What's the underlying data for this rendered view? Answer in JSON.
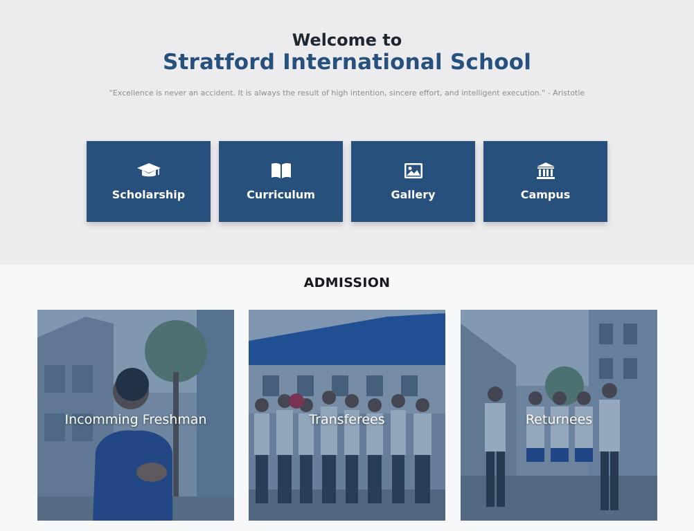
{
  "hero": {
    "welcome": "Welcome to",
    "school_name": "Stratford International School",
    "quote": "\"Excellence is never an accident. It is always the result of high intention, sincere effort, and intelligent execution.\" - Aristotle"
  },
  "quick_links": [
    {
      "label": "Scholarship",
      "icon": "graduation-cap-icon"
    },
    {
      "label": "Curriculum",
      "icon": "book-icon"
    },
    {
      "label": "Gallery",
      "icon": "image-icon"
    },
    {
      "label": "Campus",
      "icon": "institution-icon"
    }
  ],
  "admission": {
    "title": "ADMISSION",
    "cards": [
      {
        "label": "Incomming Freshman"
      },
      {
        "label": "Transferees"
      },
      {
        "label": "Returnees"
      }
    ]
  },
  "colors": {
    "brand": "#27507d",
    "hero_bg": "#ececee",
    "page_bg": "#f7f8fa",
    "heading": "#1f2630"
  }
}
